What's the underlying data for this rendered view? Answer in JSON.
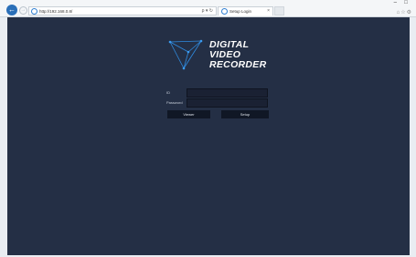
{
  "browser": {
    "url": "http://192.168.0.8/",
    "address_controls": "ρ ▾ ↻",
    "tab_title": "Setup Login",
    "tab_close": "×",
    "window_buttons": [
      "–",
      "□"
    ],
    "toolbar_icons": [
      "home-icon",
      "star-icon",
      "gear-icon"
    ]
  },
  "app": {
    "brand_line1": "DIGITAL",
    "brand_line2": "VIDEO",
    "brand_line3": "RECORDER",
    "background_color": "#242f45"
  },
  "login": {
    "id_label": "ID",
    "id_value": "",
    "password_label": "Password",
    "password_value": "",
    "viewer_button": "Viewer",
    "setup_button": "Setup"
  }
}
